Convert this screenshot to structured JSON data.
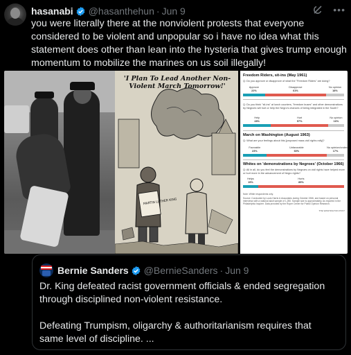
{
  "tweet": {
    "author_name": "hasanabi",
    "handle": "@hasanthehun",
    "separator": "·",
    "date": "Jun 9",
    "more_label": "•••",
    "text": "you were literally there at the nonviolent protests that everyone considered to be violent and unpopular so i have no idea what this statement does other than lean into the hysteria that gives trump enough momentum to mobilize the marines on us soil illegally!",
    "icons": [
      "avatar",
      "verified-badge-icon",
      "grok-icon",
      "more-icon"
    ]
  },
  "media": {
    "cartoon": {
      "caption": "'I Plan To Lead Another Non-Violent March Tomorrow!'",
      "sign_text": "MARTIN LUTHER KING"
    },
    "poll": {
      "sections": [
        {
          "title": "Freedom Riders, sit-ins (May 1961)",
          "question": "Q: Do you approve or disapprove of what the \"Freedom Riders\" are doing?",
          "labels": [
            "Approve",
            "Disapprove",
            "No opinion"
          ],
          "values": [
            22,
            61,
            18
          ],
          "value_labels": [
            "22%",
            "61%",
            "18%"
          ]
        },
        {
          "title": "",
          "question": "Q: Do you think \"sit-ins\" at lunch counters, \"freedom buses\" and other demonstrations by Negroes will hurt or help the Negro's chances of being integrated in the South?",
          "labels": [
            "Help",
            "Hurt",
            "No opinion"
          ],
          "values": [
            28,
            57,
            16
          ],
          "value_labels": [
            "28%",
            "57%",
            "16%"
          ]
        },
        {
          "title": "March on Washington (August 1963)",
          "question": "Q: What are your feelings about this [proposed mass civil rights rally]?",
          "labels": [
            "Favorable",
            "Unfavorable",
            "No opinion/undecided"
          ],
          "values": [
            23,
            60,
            17
          ],
          "value_labels": [
            "23%",
            "60%",
            "17%"
          ]
        },
        {
          "title": "Whites on 'demonstrations by Negroes' (October 1966)",
          "question": "Q: All in all, do you feel the demonstrations by Negroes on civil rights have helped more or hurt more in the advancement of Negro rights?",
          "labels": [
            "Helps",
            "Hurts"
          ],
          "values": [
            15,
            85
          ],
          "value_labels": [
            "15%",
            "85%"
          ]
        }
      ],
      "note": "Note: White respondents only.",
      "source": "Source: Conducted by Louis Harris & Associates during October 1966, and based on personal interviews with a national adult sample of 1,250. Sample size is approximately. As reported in the Philadelphia Inquirer. Data provided by the Roper Center for Public Opinion Research.",
      "credit": "THE WASHINGTON POST",
      "colors": {
        "positive": "#1a9fb5",
        "negative": "#e05a4f",
        "neutral": "#c8c8c8"
      }
    }
  },
  "quote": {
    "author_name": "Bernie Sanders",
    "handle": "@BernieSanders",
    "separator": "·",
    "date": "Jun 9",
    "paragraph1": "Dr. King defeated racist government officials & ended segregation through disciplined non-violent resistance.",
    "paragraph2": "Defeating Trumpism, oligarchy & authoritarianism requires that same level of discipline. ..."
  },
  "colors": {
    "background": "#000000",
    "text_primary": "#e7e9ea",
    "text_secondary": "#71767b",
    "verified_blue": "#1d9bf0",
    "border": "#2f3336"
  }
}
